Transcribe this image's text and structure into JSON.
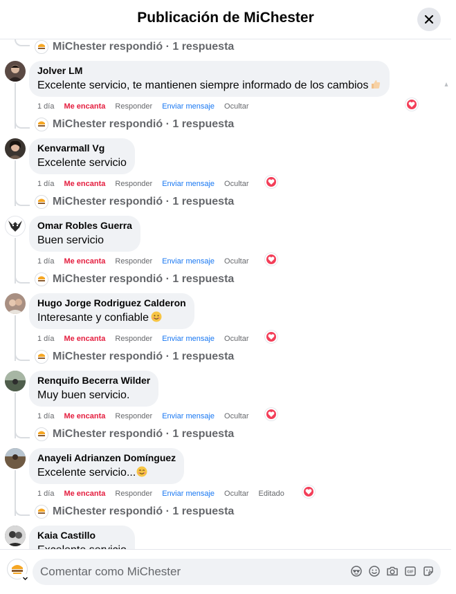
{
  "header": {
    "title": "Publicación de MiChester"
  },
  "brand": {
    "page_name": "MiChester",
    "logo_text": "MiChester"
  },
  "actions": {
    "love": "Me encanta",
    "reply": "Responder",
    "send_message": "Enviar mensaje",
    "hide": "Ocultar"
  },
  "colors": {
    "love": "#e41e3f",
    "link": "#1877f2",
    "reaction_heart": "#f33e58",
    "muted": "#65676b"
  },
  "replies_summary": "MiChester respondió · 1 respuesta",
  "comments": [
    {
      "author": "Jolver LM",
      "text": "Excelente servicio, te mantienen siempre informado de los cambios",
      "emoji": "thumbs-up-icon",
      "time": "1 día",
      "edited": "",
      "reaction": "heart-icon",
      "avatar_color": "#5b4a44"
    },
    {
      "author": "Kenvarmall Vg",
      "text": "Excelente servicio",
      "emoji": "",
      "time": "1 día",
      "edited": "",
      "reaction": "heart-icon",
      "avatar_color": "#3b3530"
    },
    {
      "author": "Omar Robles Guerra",
      "text": "Buen servicio",
      "emoji": "",
      "time": "1 día",
      "edited": "",
      "reaction": "heart-icon",
      "avatar_color": "#ffffff"
    },
    {
      "author": "Hugo Jorge Rodriguez Calderon",
      "text": "Interesante y confiable",
      "emoji": "smiling-face-icon",
      "time": "1 día",
      "edited": "",
      "reaction": "heart-icon",
      "avatar_color": "#a88f82"
    },
    {
      "author": "Renquifo Becerra Wilder",
      "text": "Muy buen servicio.",
      "emoji": "",
      "time": "1 día",
      "edited": "",
      "reaction": "heart-icon",
      "avatar_color": "#6c7a6a"
    },
    {
      "author": "Anayeli Adrianzen Domínguez",
      "text": "Excelente servicio...",
      "emoji": "smiling-face-icon",
      "time": "1 día",
      "edited": "Editado",
      "reaction": "heart-icon",
      "avatar_color": "#8b7460"
    },
    {
      "author": "Kaia Castillo",
      "text": "Excelente servicio",
      "emoji": "",
      "time": "",
      "edited": "",
      "reaction": "",
      "avatar_color": "#4a4a4a"
    }
  ],
  "composer": {
    "placeholder": "Comentar como MiChester"
  },
  "composer_tools": [
    "avatar-sticker-icon",
    "emoji-icon",
    "camera-icon",
    "gif-icon",
    "sticker-icon"
  ]
}
